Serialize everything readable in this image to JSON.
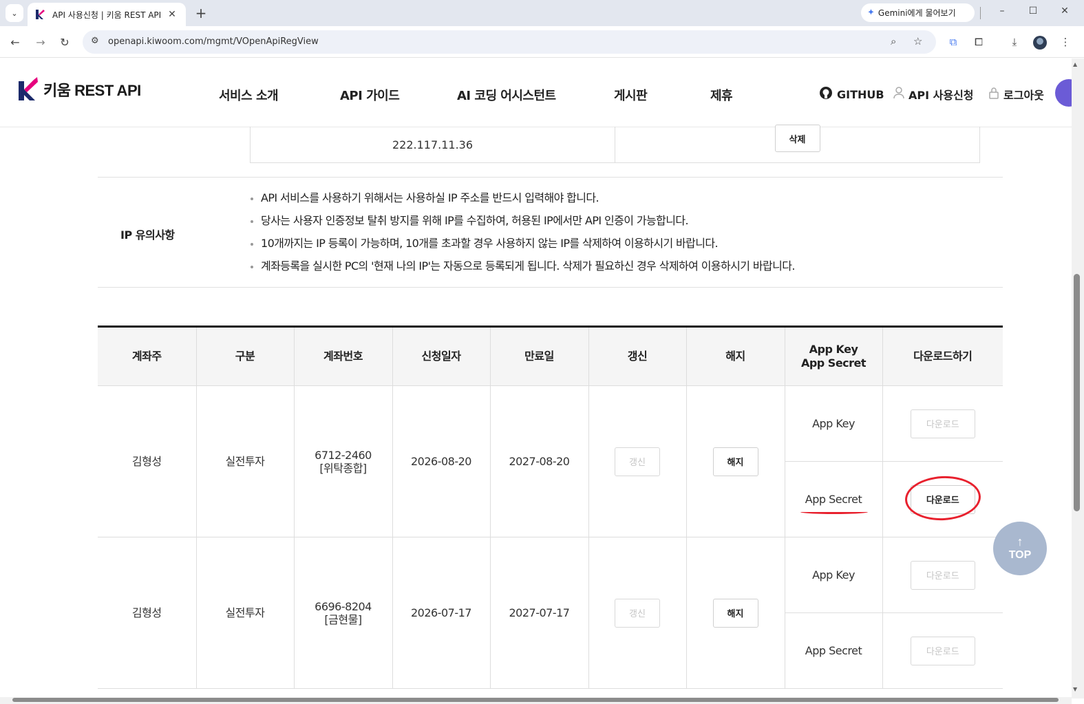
{
  "browser": {
    "tab_title": "API 사용신청 | 키움 REST API",
    "tab_close": "✕",
    "new_tab": "+",
    "gemini_label": "Gemini에게 물어보기",
    "url": "openapi.kiwoom.com/mgmt/VOpenApiRegView",
    "window_controls": [
      "–",
      "☐",
      "✕"
    ]
  },
  "site": {
    "logo_text": "키움 REST API",
    "nav": [
      "서비스 소개",
      "API 가이드",
      "AI 코딩 어시스턴트",
      "게시판",
      "제휴"
    ],
    "util": {
      "github": "GITHUB",
      "api_apply": "API 사용신청",
      "logout": "로그아웃"
    }
  },
  "ip_table": {
    "address": "222.117.11.36",
    "delete_label": "삭제"
  },
  "notice": {
    "title": "IP 유의사항",
    "items": [
      "API 서비스를 사용하기 위해서는 사용하실 IP 주소를 반드시 입력해야 합니다.",
      "당사는 사용자 인증정보 탈취 방지를 위해 IP를 수집하여, 허용된 IP에서만 API 인증이 가능합니다.",
      "10개까지는 IP 등록이 가능하며, 10개를 초과할 경우 사용하지 않는 IP를 삭제하여 이용하시기 바랍니다.",
      "계좌등록을 실시한 PC의 '현재 나의 IP'는 자동으로 등록되게 됩니다. 삭제가 필요하신 경우 삭제하여 이용하시기 바랍니다."
    ]
  },
  "accounts": {
    "headers": [
      "계좌주",
      "구분",
      "계좌번호",
      "신청일자",
      "만료일",
      "갱신",
      "해지",
      "App Key",
      "App Secret",
      "다운로드하기"
    ],
    "rows": [
      {
        "owner": "김형성",
        "type": "실전투자",
        "account_no": "6712-2460",
        "account_kind": "[위탁종합]",
        "apply_date": "2026-08-20",
        "expire_date": "2027-08-20",
        "renew_label": "갱신",
        "cancel_label": "해지",
        "key_label": "App Key",
        "secret_label": "App Secret",
        "download_label": "다운로드",
        "key_download_enabled": false,
        "secret_download_enabled": true
      },
      {
        "owner": "김형성",
        "type": "실전투자",
        "account_no": "6696-8204",
        "account_kind": "[금현물]",
        "apply_date": "2026-07-17",
        "expire_date": "2027-07-17",
        "renew_label": "갱신",
        "cancel_label": "해지",
        "key_label": "App Key",
        "secret_label": "App Secret",
        "download_label": "다운로드",
        "key_download_enabled": false,
        "secret_download_enabled": false
      }
    ]
  },
  "top_button": {
    "label": "TOP"
  },
  "colors": {
    "annotation": "#e8212e",
    "brand_pink": "#e6007e",
    "brand_navy": "#1c2a6b"
  }
}
